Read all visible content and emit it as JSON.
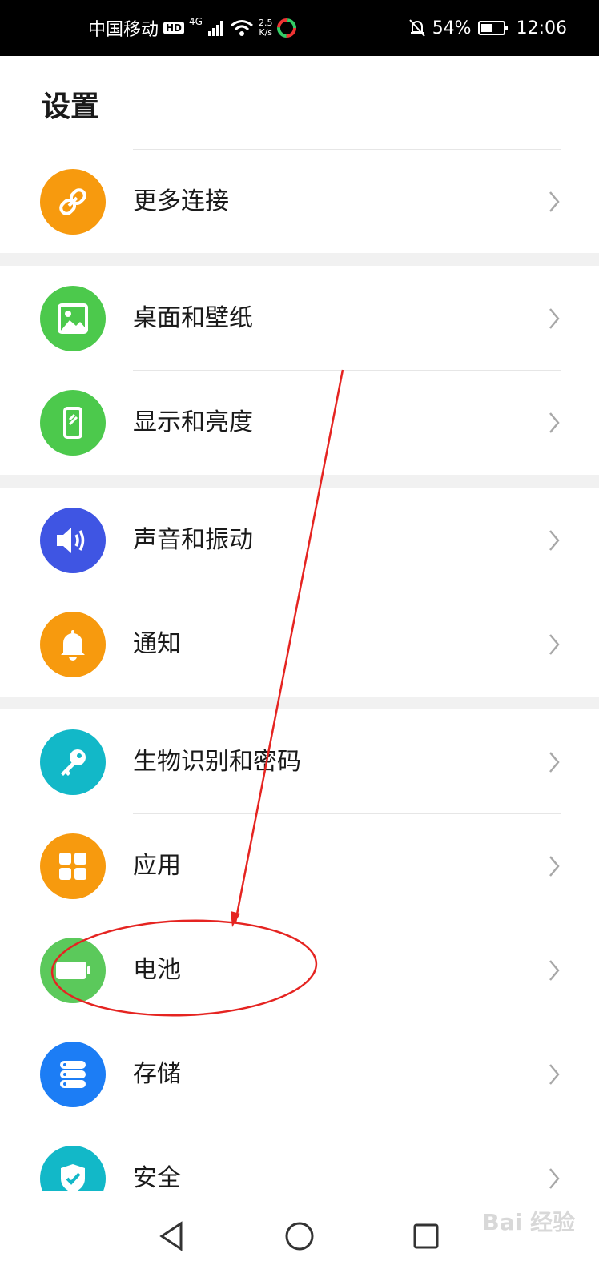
{
  "status_bar": {
    "carrier": "中国移动",
    "hd": "HD",
    "network_type": "4G",
    "speed_value": "2.5",
    "speed_unit": "K/s",
    "battery": "54%",
    "battery_level": 0.54,
    "time": "12:06"
  },
  "page": {
    "title": "设置"
  },
  "items": [
    {
      "label": "更多连接",
      "icon": "link-icon",
      "color": "#F79A0E"
    },
    {
      "label": "桌面和壁纸",
      "icon": "image-icon",
      "color": "#4CC94C"
    },
    {
      "label": "显示和亮度",
      "icon": "phone-brightness-icon",
      "color": "#4CC94C"
    },
    {
      "label": "声音和振动",
      "icon": "speaker-icon",
      "color": "#3F55E3"
    },
    {
      "label": "通知",
      "icon": "bell-icon",
      "color": "#F79A0E"
    },
    {
      "label": "生物识别和密码",
      "icon": "key-icon",
      "color": "#12B8C8"
    },
    {
      "label": "应用",
      "icon": "apps-grid-icon",
      "color": "#F79A0E"
    },
    {
      "label": "电池",
      "icon": "battery-icon",
      "color": "#5BC95B"
    },
    {
      "label": "存储",
      "icon": "storage-icon",
      "color": "#1C7DF5"
    },
    {
      "label": "安全",
      "icon": "shield-check-icon",
      "color": "#12B8C8"
    }
  ],
  "annotation_color": "#E52421",
  "watermark": "Bai 经验"
}
